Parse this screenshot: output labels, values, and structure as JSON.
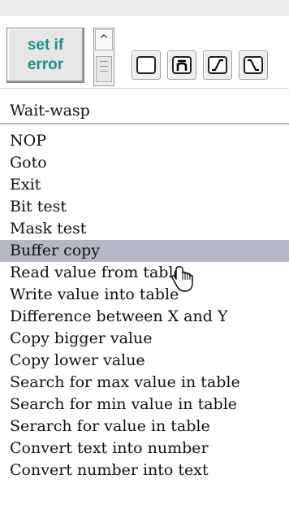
{
  "toolbar": {
    "set_if_error_label": "set if\nerror",
    "scroll_up_glyph": "^",
    "tools": [
      {
        "name": "blank-block-icon"
      },
      {
        "name": "n-bar-block-icon",
        "glyph": "n̄"
      },
      {
        "name": "rising-curve-icon"
      },
      {
        "name": "falling-curve-icon"
      }
    ]
  },
  "list_header": "Wait-wasp",
  "list": {
    "items": [
      "NOP",
      "Goto",
      "Exit",
      "Bit test",
      "Mask test",
      "Buffer copy",
      "Read value from table",
      "Write value into table",
      "Difference between X and Y",
      "Copy bigger value",
      "Copy lower value",
      "Search for max value in table",
      "Search for min value in table",
      "Serarch for value in table",
      "Convert text into number",
      "Convert number into text"
    ],
    "selected_index": 5
  }
}
